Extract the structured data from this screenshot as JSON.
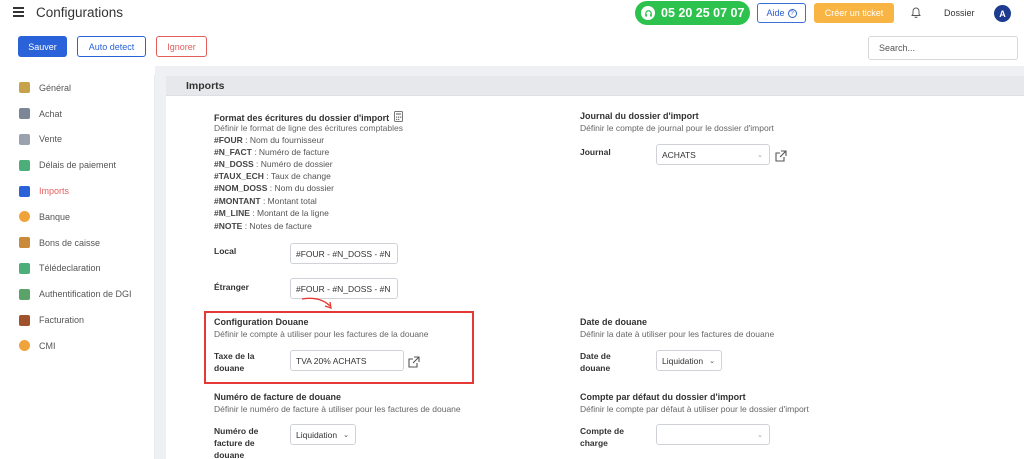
{
  "topbar": {
    "title": "Configurations",
    "phone": "05 20 25 07 07",
    "aide": "Aide",
    "ticket": "Créer un ticket",
    "dossier": "Dossier",
    "avatar": "A"
  },
  "actions": {
    "save": "Sauver",
    "auto": "Auto detect",
    "ignore": "Ignorer",
    "search_placeholder": "Search..."
  },
  "sidebar": {
    "items": [
      {
        "label": "Général",
        "color": "#c7a24a"
      },
      {
        "label": "Achat",
        "color": "#7b8796"
      },
      {
        "label": "Vente",
        "color": "#9aa3ad"
      },
      {
        "label": "Délais de paiement",
        "color": "#4caf7a"
      },
      {
        "label": "Imports",
        "color": "#2a62d9"
      },
      {
        "label": "Banque",
        "color": "#f0a33a"
      },
      {
        "label": "Bons de caisse",
        "color": "#c98a3a"
      },
      {
        "label": "Télédeclaration",
        "color": "#4caf7a"
      },
      {
        "label": "Authentification de DGI",
        "color": "#5aa469"
      },
      {
        "label": "Facturation",
        "color": "#a0522d"
      },
      {
        "label": "CMI",
        "color": "#f0a33a"
      }
    ],
    "active_index": 4
  },
  "section_title": "Imports",
  "format": {
    "title": "Format des écritures du dossier d'import",
    "desc": "Définir le format de ligne des écritures comptables",
    "codes": [
      {
        "code": "#FOUR",
        "desc": " : Nom du fournisseur"
      },
      {
        "code": "#N_FACT",
        "desc": " : Numéro de facture"
      },
      {
        "code": "#N_DOSS",
        "desc": " : Numéro de dossier"
      },
      {
        "code": "#TAUX_ECH",
        "desc": " : Taux de change"
      },
      {
        "code": "#NOM_DOSS",
        "desc": " : Nom du dossier"
      },
      {
        "code": "#MONTANT",
        "desc": " : Montant total"
      },
      {
        "code": "#M_LINE",
        "desc": " : Montant de la ligne"
      },
      {
        "code": "#NOTE",
        "desc": " : Notes de facture"
      }
    ],
    "local_label": "Local",
    "local_value": "#FOUR - #N_DOSS - #N",
    "etranger_label": "Étranger",
    "etranger_value": "#FOUR - #N_DOSS - #N"
  },
  "journal": {
    "title": "Journal du dossier d'import",
    "desc": "Définir le compte de journal pour le dossier d'import",
    "label": "Journal",
    "value": "ACHATS"
  },
  "douane": {
    "title": "Configuration Douane",
    "desc": "Définir le compte à utiliser pour les factures de la douane",
    "label_1": "Taxe de la",
    "label_2": "douane",
    "value": "TVA 20% ACHATS"
  },
  "date_douane": {
    "title": "Date de douane",
    "desc": "Définir la date à utiliser pour les factures de douane",
    "label_1": "Date de",
    "label_2": "douane",
    "value": "Liquidation"
  },
  "num_facture": {
    "title": "Numéro de facture de douane",
    "desc": "Définir le numéro de facture à utiliser pour les factures de douane",
    "label_1": "Numéro de",
    "label_2": "facture de",
    "label_3": "douane",
    "value": "Liquidation"
  },
  "compte_defaut": {
    "title": "Compte par défaut du dossier d'import",
    "desc": "Définir le compte par défaut à utiliser pour le dossier d'import",
    "label_1": "Compte de",
    "label_2": "charge",
    "value": ""
  }
}
